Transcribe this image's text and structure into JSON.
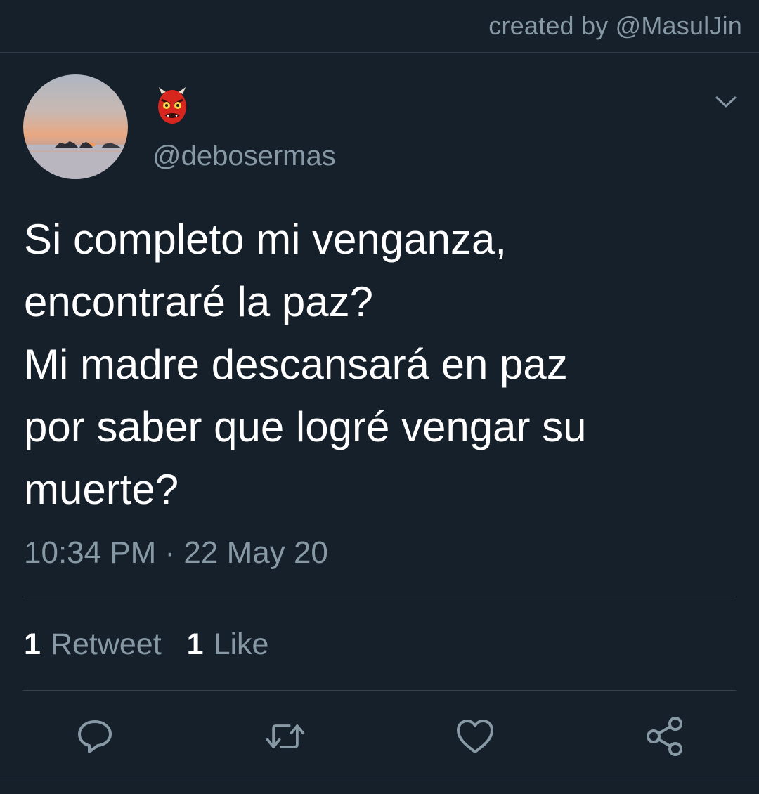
{
  "watermark": "created by @MasulJin",
  "tweet": {
    "display_name_icon": "red-oni-mask-emoji",
    "handle": "@debosermas",
    "text": "Si completo mi venganza,\nencontraré la paz?\nMi madre descansará en paz\npor saber que logré vengar su\nmuerte?",
    "timestamp": "10:34 PM · 22 May 20"
  },
  "stats": {
    "retweets_count": "1",
    "retweets_label": "Retweet",
    "likes_count": "1",
    "likes_label": "Like"
  },
  "actions": {
    "reply_icon": "reply-icon",
    "retweet_icon": "retweet-icon",
    "like_icon": "heart-icon",
    "share_icon": "share-icon"
  },
  "colors": {
    "background": "#16202b",
    "secondary_text": "#8899a6",
    "divider": "#38444d",
    "primary_text": "#ffffff"
  }
}
